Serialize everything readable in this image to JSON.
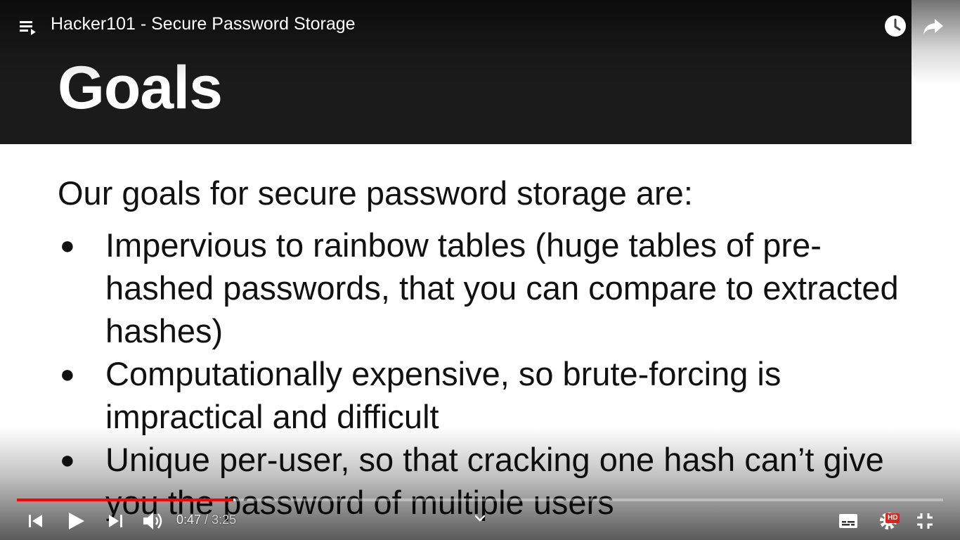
{
  "player": {
    "title": "Hacker101 - Secure Password Storage",
    "time": {
      "current": "0:47",
      "separator": " / ",
      "duration": "3:25"
    },
    "progress": {
      "played_fraction": 0.234,
      "buffered_fraction": 0.236
    },
    "hd_badge": "HD",
    "icons": {
      "playlist": "playlist-icon",
      "watch_later": "clock-icon",
      "share": "share-icon",
      "previous": "skip-previous-icon",
      "play": "play-icon",
      "next": "skip-next-icon",
      "volume": "volume-icon",
      "chevron": "chevron-down-icon",
      "subtitles": "subtitles-icon",
      "settings": "gear-icon",
      "exit_fullscreen": "exit-fullscreen-icon"
    },
    "colors": {
      "progress_played": "#ff0000",
      "hd_badge": "#e62117",
      "slide_header": "#1b1b1b"
    }
  },
  "slide": {
    "title": "Goals",
    "intro": "Our goals for secure password storage are:",
    "bullets": [
      "Impervious to rainbow tables (huge tables of pre-hashed passwords, that you can compare to extracted hashes)",
      "Computationally expensive, so brute-forcing is impractical and difficult",
      "Unique per-user, so that cracking one hash can’t give you the password of multiple users"
    ],
    "bullet_symbol": "●"
  }
}
